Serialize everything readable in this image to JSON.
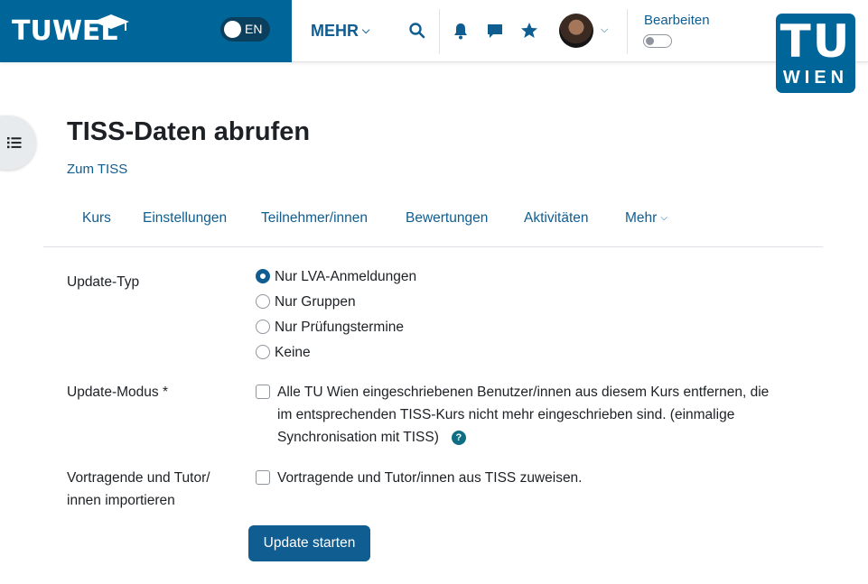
{
  "navbar": {
    "brand": "TUWEL",
    "language": "EN",
    "more_menu": "MEHR",
    "edit_mode_label": "Bearbeiten",
    "edit_mode_on": false,
    "brand_color": "#006699"
  },
  "institution_logo": {
    "line1": "TU",
    "line2": "WIEN"
  },
  "page": {
    "title": "TISS-Daten abrufen",
    "back_link": "Zum TISS"
  },
  "tabs": [
    {
      "label": "Kurs"
    },
    {
      "label": "Einstellungen"
    },
    {
      "label": "Teilnehmer/innen"
    },
    {
      "label": "Bewertungen"
    },
    {
      "label": "Aktivitäten"
    },
    {
      "label": "Mehr"
    }
  ],
  "form": {
    "update_type": {
      "label": "Update-Typ",
      "options": [
        {
          "label": "Nur LVA-Anmeldungen",
          "checked": true
        },
        {
          "label": "Nur Gruppen",
          "checked": false
        },
        {
          "label": "Nur Prüfungstermine",
          "checked": false
        },
        {
          "label": "Keine",
          "checked": false
        }
      ]
    },
    "update_mode": {
      "label": "Update-Modus *",
      "checkbox_line1": "Alle TU Wien eingeschriebenen Benutzer/innen aus diesem Kurs entfernen, die",
      "checkbox_line2": "im entsprechenden TISS-Kurs nicht mehr eingeschrieben sind. (einmalige",
      "checkbox_line3": "Synchronisation mit TISS)",
      "help": "?",
      "checked": false
    },
    "import_staff": {
      "label_line1": "Vortragende und Tutor/",
      "label_line2": "innen importieren",
      "checkbox_label": "Vortragende und Tutor/innen aus TISS zuweisen.",
      "checked": false
    },
    "submit_label": "Update starten"
  }
}
